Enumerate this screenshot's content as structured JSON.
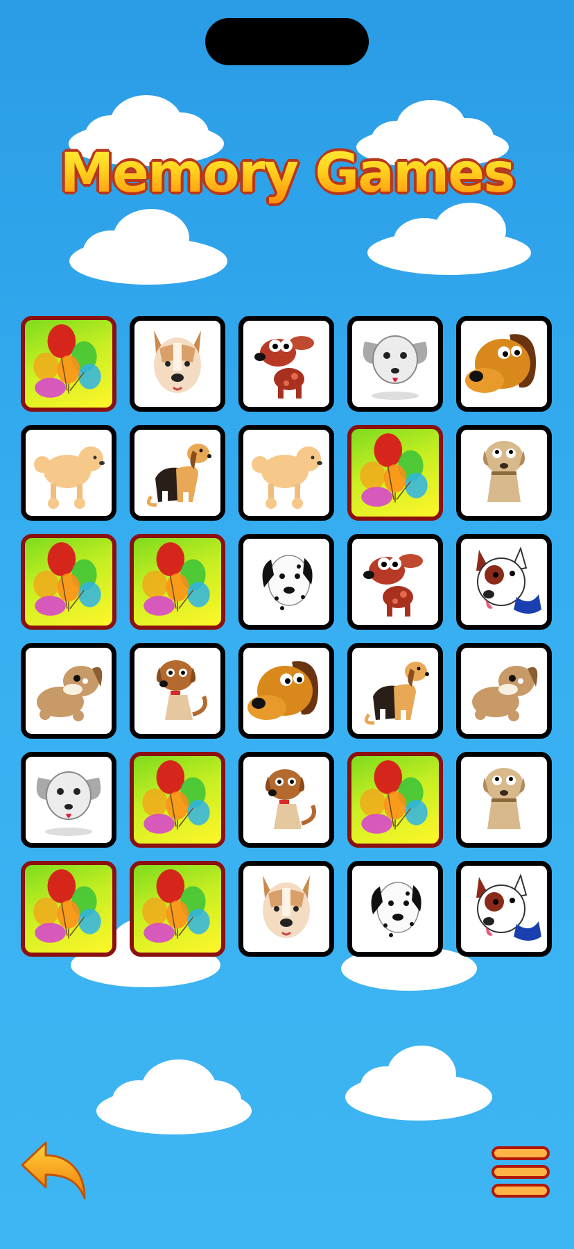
{
  "title": "Memory Games",
  "colors": {
    "sky": "#36aef0",
    "card_back_border": "#8b1010",
    "card_face_border": "#000000",
    "title_fill": "#ffd21e",
    "title_outline": "#b8361c"
  },
  "board": {
    "rows": 6,
    "cols": 5,
    "cards": [
      {
        "state": "hidden",
        "icon": "balloons-icon"
      },
      {
        "state": "revealed",
        "icon": "pitbull-dog-icon"
      },
      {
        "state": "revealed",
        "icon": "red-puppy-icon"
      },
      {
        "state": "revealed",
        "icon": "grey-dog-icon"
      },
      {
        "state": "revealed",
        "icon": "brown-dog-face-icon"
      },
      {
        "state": "revealed",
        "icon": "poodle-icon"
      },
      {
        "state": "revealed",
        "icon": "beagle-icon"
      },
      {
        "state": "revealed",
        "icon": "poodle-icon"
      },
      {
        "state": "hidden",
        "icon": "balloons-icon"
      },
      {
        "state": "revealed",
        "icon": "tan-puppy-icon"
      },
      {
        "state": "hidden",
        "icon": "balloons-icon"
      },
      {
        "state": "hidden",
        "icon": "balloons-icon"
      },
      {
        "state": "revealed",
        "icon": "dalmatian-icon"
      },
      {
        "state": "revealed",
        "icon": "red-puppy-icon"
      },
      {
        "state": "revealed",
        "icon": "bull-terrier-icon"
      },
      {
        "state": "revealed",
        "icon": "shaggy-dog-icon"
      },
      {
        "state": "revealed",
        "icon": "scruffy-puppy-icon"
      },
      {
        "state": "revealed",
        "icon": "brown-dog-face-icon"
      },
      {
        "state": "revealed",
        "icon": "beagle-icon"
      },
      {
        "state": "revealed",
        "icon": "shaggy-dog-icon"
      },
      {
        "state": "revealed",
        "icon": "grey-dog-icon"
      },
      {
        "state": "hidden",
        "icon": "balloons-icon"
      },
      {
        "state": "revealed",
        "icon": "scruffy-puppy-icon"
      },
      {
        "state": "hidden",
        "icon": "balloons-icon"
      },
      {
        "state": "revealed",
        "icon": "tan-puppy-icon"
      },
      {
        "state": "hidden",
        "icon": "balloons-icon"
      },
      {
        "state": "hidden",
        "icon": "balloons-icon"
      },
      {
        "state": "revealed",
        "icon": "pitbull-dog-icon"
      },
      {
        "state": "revealed",
        "icon": "dalmatian-icon"
      },
      {
        "state": "revealed",
        "icon": "bull-terrier-icon"
      }
    ]
  },
  "controls": {
    "back_icon": "back-arrow-icon",
    "menu_icon": "hamburger-menu-icon"
  }
}
